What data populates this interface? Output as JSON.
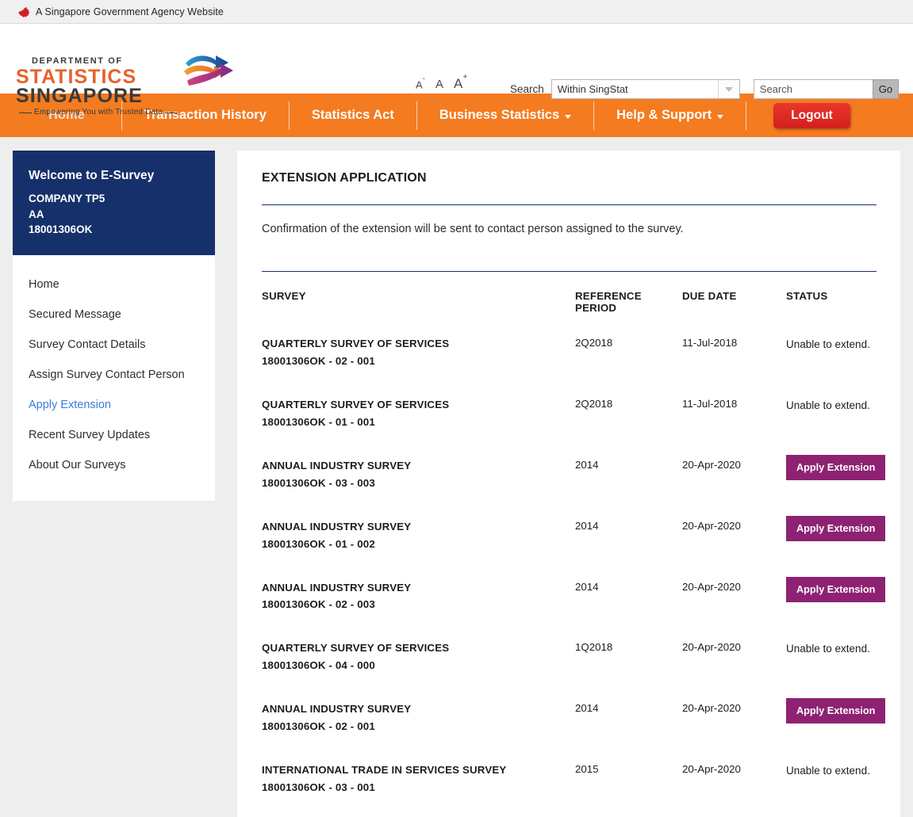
{
  "gov_banner": {
    "text": "A Singapore Government Agency Website",
    "icon": "singapore-lion-icon"
  },
  "logo": {
    "line1": "DEPARTMENT OF",
    "line2": "STATISTICS",
    "line3": "SINGAPORE",
    "tagline": "Empowering You with Trusted Data",
    "colors": {
      "orange": "#e8622a",
      "dark": "#3a3a3a"
    }
  },
  "header": {
    "font_size_small": "A",
    "font_size_small_sup": "-",
    "font_size_medium": "A",
    "font_size_large": "A",
    "font_size_large_sup": "+",
    "search_label": "Search",
    "scope_selected": "Within SingStat",
    "search_placeholder": "Search",
    "search_value": "",
    "go_label": "Go"
  },
  "nav": {
    "items": [
      {
        "label": "Home",
        "has_caret": false
      },
      {
        "label": "Transaction History",
        "has_caret": false
      },
      {
        "label": "Statistics Act",
        "has_caret": false
      },
      {
        "label": "Business Statistics",
        "has_caret": true
      },
      {
        "label": "Help & Support",
        "has_caret": true
      }
    ],
    "logout_label": "Logout",
    "bar_color": "#f47b20",
    "logout_color": "#d41f1b"
  },
  "sidebar": {
    "welcome_title": "Welcome to E-Survey",
    "company": "COMPANY TP5",
    "company_code": "AA",
    "company_id": "18001306OK",
    "box_color": "#16306b",
    "items": [
      {
        "label": "Home",
        "active": false
      },
      {
        "label": "Secured Message",
        "active": false
      },
      {
        "label": "Survey Contact Details",
        "active": false
      },
      {
        "label": "Assign Survey Contact Person",
        "active": false
      },
      {
        "label": "Apply Extension",
        "active": true
      },
      {
        "label": "Recent Survey Updates",
        "active": false
      },
      {
        "label": "About Our Surveys",
        "active": false
      }
    ],
    "active_color": "#3b7dd8"
  },
  "main": {
    "title": "EXTENSION APPLICATION",
    "intro": "Confirmation of the extension will be sent to contact person assigned to the survey.",
    "table": {
      "headers": {
        "survey": "SURVEY",
        "reference_period": "REFERENCE PERIOD",
        "due_date": "DUE DATE",
        "status": "STATUS"
      },
      "apply_label": "Apply Extension",
      "apply_color": "#8e2272",
      "rows": [
        {
          "survey": "QUARTERLY SURVEY OF SERVICES",
          "ref": "18001306OK - 02 - 001",
          "period": "2Q2018",
          "due": "11-Jul-2018",
          "status": "Unable to extend.",
          "can_apply": false
        },
        {
          "survey": "QUARTERLY SURVEY OF SERVICES",
          "ref": "18001306OK - 01 - 001",
          "period": "2Q2018",
          "due": "11-Jul-2018",
          "status": "Unable to extend.",
          "can_apply": false
        },
        {
          "survey": "ANNUAL INDUSTRY SURVEY",
          "ref": "18001306OK - 03 - 003",
          "period": "2014",
          "due": "20-Apr-2020",
          "status": "Apply Extension",
          "can_apply": true
        },
        {
          "survey": "ANNUAL INDUSTRY SURVEY",
          "ref": "18001306OK - 01 - 002",
          "period": "2014",
          "due": "20-Apr-2020",
          "status": "Apply Extension",
          "can_apply": true
        },
        {
          "survey": "ANNUAL INDUSTRY SURVEY",
          "ref": "18001306OK - 02 - 003",
          "period": "2014",
          "due": "20-Apr-2020",
          "status": "Apply Extension",
          "can_apply": true
        },
        {
          "survey": "QUARTERLY SURVEY OF SERVICES",
          "ref": "18001306OK - 04 - 000",
          "period": "1Q2018",
          "due": "20-Apr-2020",
          "status": "Unable to extend.",
          "can_apply": false
        },
        {
          "survey": "ANNUAL INDUSTRY SURVEY",
          "ref": "18001306OK - 02 - 001",
          "period": "2014",
          "due": "20-Apr-2020",
          "status": "Apply Extension",
          "can_apply": true
        },
        {
          "survey": "INTERNATIONAL TRADE IN SERVICES SURVEY",
          "ref": "18001306OK - 03 - 001",
          "period": "2015",
          "due": "20-Apr-2020",
          "status": "Unable to extend.",
          "can_apply": false
        }
      ]
    }
  }
}
